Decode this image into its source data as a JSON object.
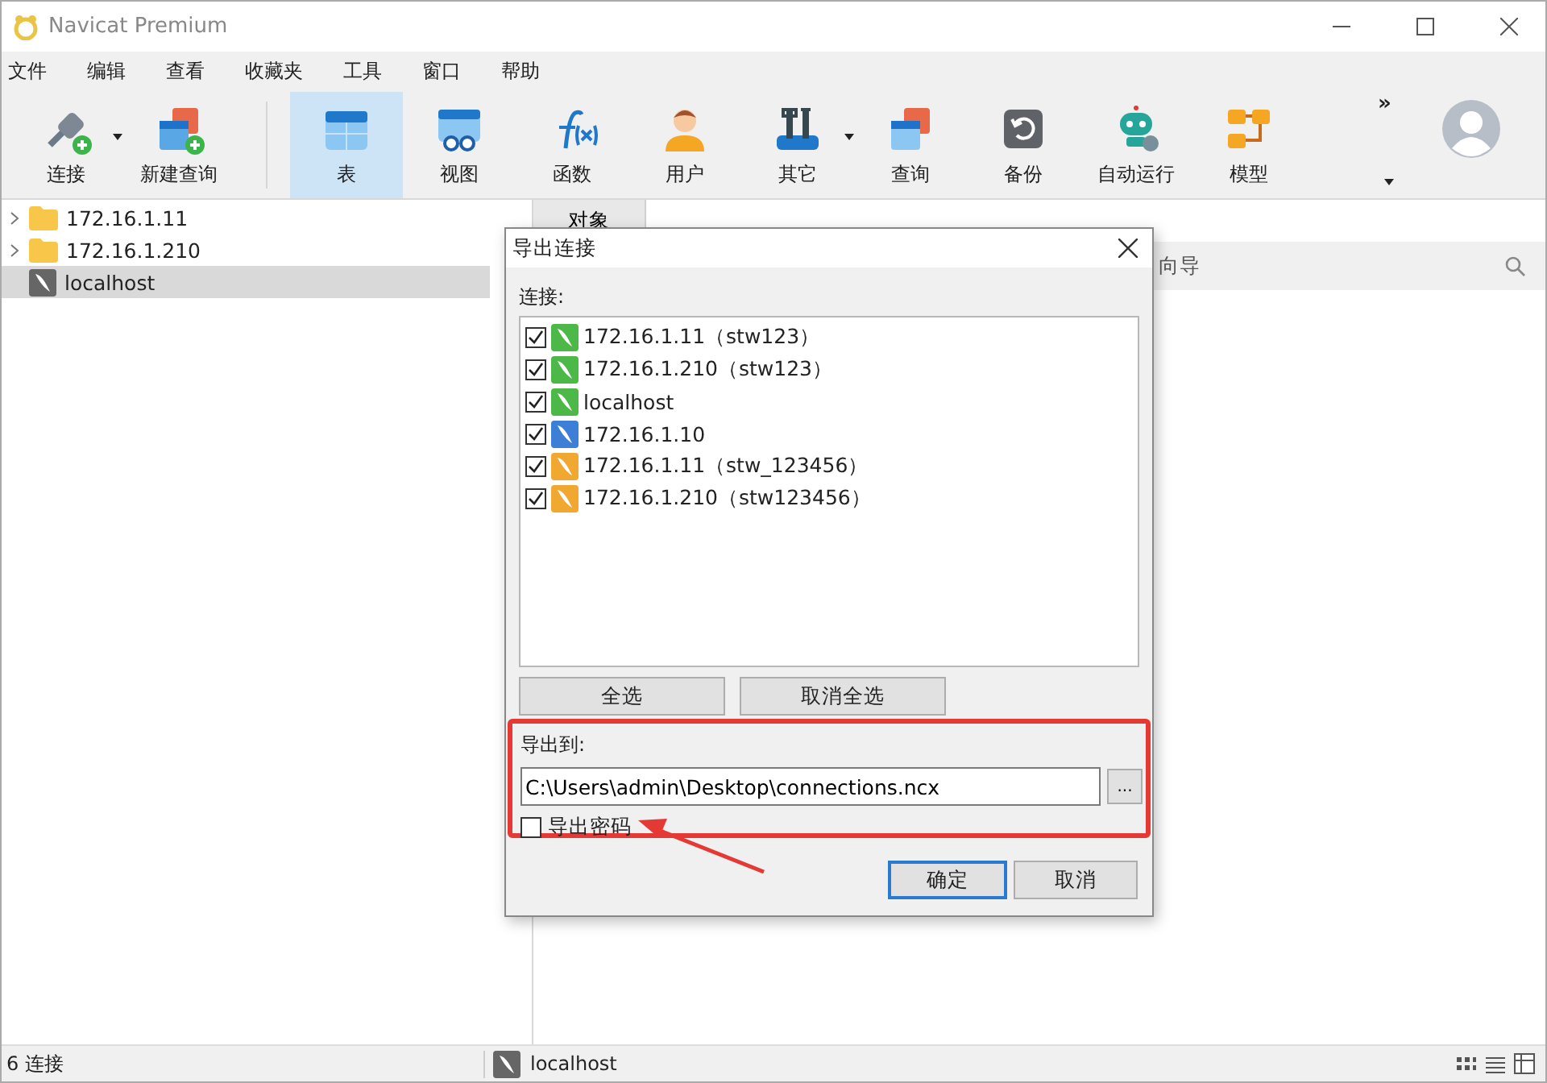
{
  "window": {
    "title": "Navicat Premium"
  },
  "menu": [
    "文件",
    "编辑",
    "查看",
    "收藏夹",
    "工具",
    "窗口",
    "帮助"
  ],
  "toolbar": [
    {
      "label": "连接",
      "kind": "connect",
      "dropdown": true,
      "selected": false
    },
    {
      "label": "新建查询",
      "kind": "new-query",
      "dropdown": false,
      "selected": false
    },
    {
      "label": "表",
      "kind": "table",
      "dropdown": false,
      "selected": true
    },
    {
      "label": "视图",
      "kind": "view",
      "dropdown": false,
      "selected": false
    },
    {
      "label": "函数",
      "kind": "function",
      "dropdown": false,
      "selected": false
    },
    {
      "label": "用户",
      "kind": "user",
      "dropdown": false,
      "selected": false
    },
    {
      "label": "其它",
      "kind": "tools",
      "dropdown": true,
      "selected": false
    },
    {
      "label": "查询",
      "kind": "query",
      "dropdown": false,
      "selected": false
    },
    {
      "label": "备份",
      "kind": "backup",
      "dropdown": false,
      "selected": false
    },
    {
      "label": "自动运行",
      "kind": "robot",
      "dropdown": false,
      "selected": false
    },
    {
      "label": "模型",
      "kind": "model",
      "dropdown": false,
      "selected": false
    }
  ],
  "toolbar_overflow": "»",
  "tree": [
    {
      "label": "172.16.1.11",
      "kind": "folder",
      "selected": false
    },
    {
      "label": "172.16.1.210",
      "kind": "folder",
      "selected": false
    },
    {
      "label": "localhost",
      "kind": "mysql",
      "selected": true
    }
  ],
  "object_tab": {
    "label": "对象"
  },
  "pane_toolbar": {
    "text": "向导"
  },
  "dialog": {
    "title": "导出连接",
    "connections_label": "连接:",
    "connections": [
      {
        "label": "172.16.1.11（stw123）",
        "kind": "mysql",
        "checked": true
      },
      {
        "label": "172.16.1.210（stw123）",
        "kind": "mysql",
        "checked": true
      },
      {
        "label": "localhost",
        "kind": "mysql",
        "checked": true
      },
      {
        "label": "172.16.1.10",
        "kind": "postgresql",
        "checked": true
      },
      {
        "label": "172.16.1.11（stw_123456）",
        "kind": "sqlserver",
        "checked": true
      },
      {
        "label": "172.16.1.210（stw123456）",
        "kind": "sqlserver",
        "checked": true
      }
    ],
    "select_all": "全选",
    "deselect_all": "取消全选",
    "export_to_label": "导出到:",
    "path": "C:\\Users\\admin\\Desktop\\connections.ncx",
    "browse": "...",
    "export_password": {
      "label": "导出密码",
      "checked": false
    },
    "ok": "确定",
    "cancel": "取消"
  },
  "status_bar": {
    "count": "6 连接",
    "connection": "localhost"
  }
}
